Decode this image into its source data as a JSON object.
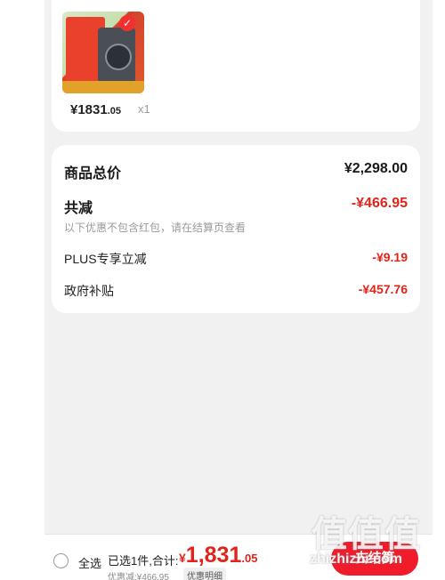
{
  "product": {
    "price_big": "¥1831",
    "price_small": ".05",
    "quantity": "x1"
  },
  "summary": {
    "total_label": "商品总价",
    "total_value": "¥2,298.00",
    "reduce_label": "共减",
    "reduce_value": "-¥466.95",
    "reduce_note": "以下优惠不包含红包，请在结算页查看",
    "plus_label": "PLUS专享立减",
    "plus_value": "-¥9.19",
    "gov_label": "政府补贴",
    "gov_value": "-¥457.76"
  },
  "bottom_bar": {
    "select_all": "全选",
    "sum_label": "已选1件,合计:",
    "sum_currency": "¥",
    "sum_big": "1,831",
    "sum_small": ".05",
    "discount_text": "优惠减:¥466.95",
    "detail_tag": "优惠明细",
    "checkout_label": "去结算"
  },
  "watermark": {
    "logo": "值值值",
    "text": "zhizhizhi.com"
  },
  "colors": {
    "accent_red": "#e2231a",
    "button_red": "#f01c2c",
    "page_bg": "#f1f1f1"
  }
}
